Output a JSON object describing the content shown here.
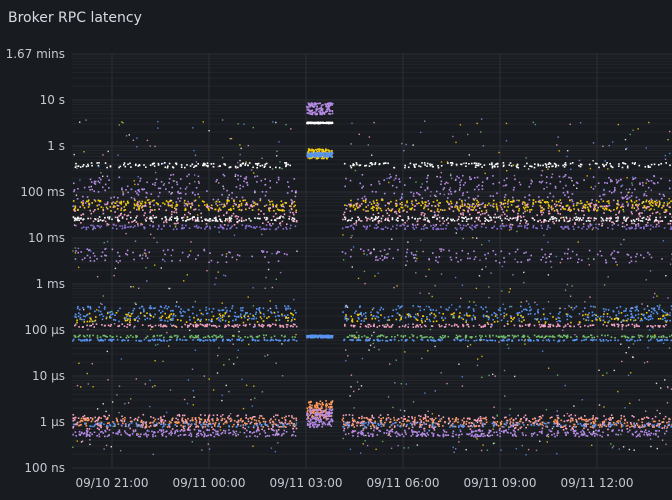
{
  "panel": {
    "title": "Broker RPC latency"
  },
  "chart_data": {
    "type": "scatter",
    "title": "Broker RPC latency",
    "y_scale": "log",
    "ylim_seconds": [
      1e-07,
      100
    ],
    "y_ticks": [
      {
        "label": "1.67 mins",
        "value": 100
      },
      {
        "label": "10 s",
        "value": 10
      },
      {
        "label": "1 s",
        "value": 1
      },
      {
        "label": "100 ms",
        "value": 0.1
      },
      {
        "label": "10 ms",
        "value": 0.01
      },
      {
        "label": "1 ms",
        "value": 0.001
      },
      {
        "label": "100 µs",
        "value": 0.0001
      },
      {
        "label": "10 µs",
        "value": 1e-05
      },
      {
        "label": "1 µs",
        "value": 1e-06
      },
      {
        "label": "100 ns",
        "value": 1e-07
      }
    ],
    "x_range": [
      "09/10 19:00",
      "09/11 14:30"
    ],
    "x_ticks": [
      {
        "label": "09/10 21:00",
        "hour": 2
      },
      {
        "label": "09/11 00:00",
        "hour": 5
      },
      {
        "label": "09/11 03:00",
        "hour": 8
      },
      {
        "label": "09/11 06:00",
        "hour": 11
      },
      {
        "label": "09/11 09:00",
        "hour": 14
      },
      {
        "label": "09/11 12:00",
        "hour": 17
      }
    ],
    "gap_hours": [
      7.7,
      9.1
    ],
    "legend": "none",
    "grid": true,
    "series": [
      {
        "color": "#ffffff",
        "band_seconds": [
          0.35,
          0.45
        ],
        "density": "line"
      },
      {
        "color": "#b58be6",
        "band_seconds": [
          0.05,
          0.25
        ],
        "density": "dense"
      },
      {
        "color": "#f2cc0c",
        "band_seconds": [
          0.04,
          0.07
        ],
        "density": "dense"
      },
      {
        "color": "#f5a3c5",
        "band_seconds": [
          0.02,
          0.06
        ],
        "density": "dense"
      },
      {
        "color": "#ffffff",
        "band_seconds": [
          0.024,
          0.03
        ],
        "density": "line"
      },
      {
        "color": "#8a6fd1",
        "band_seconds": [
          0.016,
          0.02
        ],
        "density": "line"
      },
      {
        "color": "#b58be6",
        "band_seconds": [
          0.003,
          0.006
        ],
        "density": "medium"
      },
      {
        "color": "#5794f2",
        "band_seconds": [
          0.00016,
          0.00035
        ],
        "density": "dense"
      },
      {
        "color": "#f2cc0c",
        "band_seconds": [
          0.00015,
          0.00025
        ],
        "density": "medium"
      },
      {
        "color": "#f5a3c5",
        "band_seconds": [
          0.00012,
          0.00014
        ],
        "density": "line"
      },
      {
        "color": "#73bf69",
        "band_seconds": [
          7e-05,
          8e-05
        ],
        "density": "line"
      },
      {
        "color": "#5794f2",
        "band_seconds": [
          6e-05,
          6.5e-05
        ],
        "density": "line"
      },
      {
        "color": "#ff9a5c",
        "band_seconds": [
          8e-07,
          1.3e-06
        ],
        "density": "dense"
      },
      {
        "color": "#f5a3c5",
        "band_seconds": [
          7e-07,
          1.5e-06
        ],
        "density": "dense"
      },
      {
        "color": "#b58be6",
        "band_seconds": [
          5e-07,
          7e-07
        ],
        "density": "dense"
      },
      {
        "color": "#5794f2",
        "band_seconds": [
          8e-07,
          1e-06
        ],
        "density": "medium"
      }
    ],
    "outage_series": [
      {
        "color": "#b58be6",
        "band_seconds": [
          5,
          9
        ]
      },
      {
        "color": "#ffffff",
        "band_seconds": [
          3.2,
          3.4
        ]
      },
      {
        "color": "#f2cc0c",
        "band_seconds": [
          0.55,
          0.9
        ]
      },
      {
        "color": "#5794f2",
        "band_seconds": [
          0.6,
          0.75
        ]
      },
      {
        "color": "#5794f2",
        "band_seconds": [
          7e-05,
          8e-05
        ]
      },
      {
        "color": "#ff9a5c",
        "band_seconds": [
          1.2e-06,
          3e-06
        ]
      },
      {
        "color": "#b58be6",
        "band_seconds": [
          8e-07,
          2e-06
        ]
      }
    ]
  }
}
